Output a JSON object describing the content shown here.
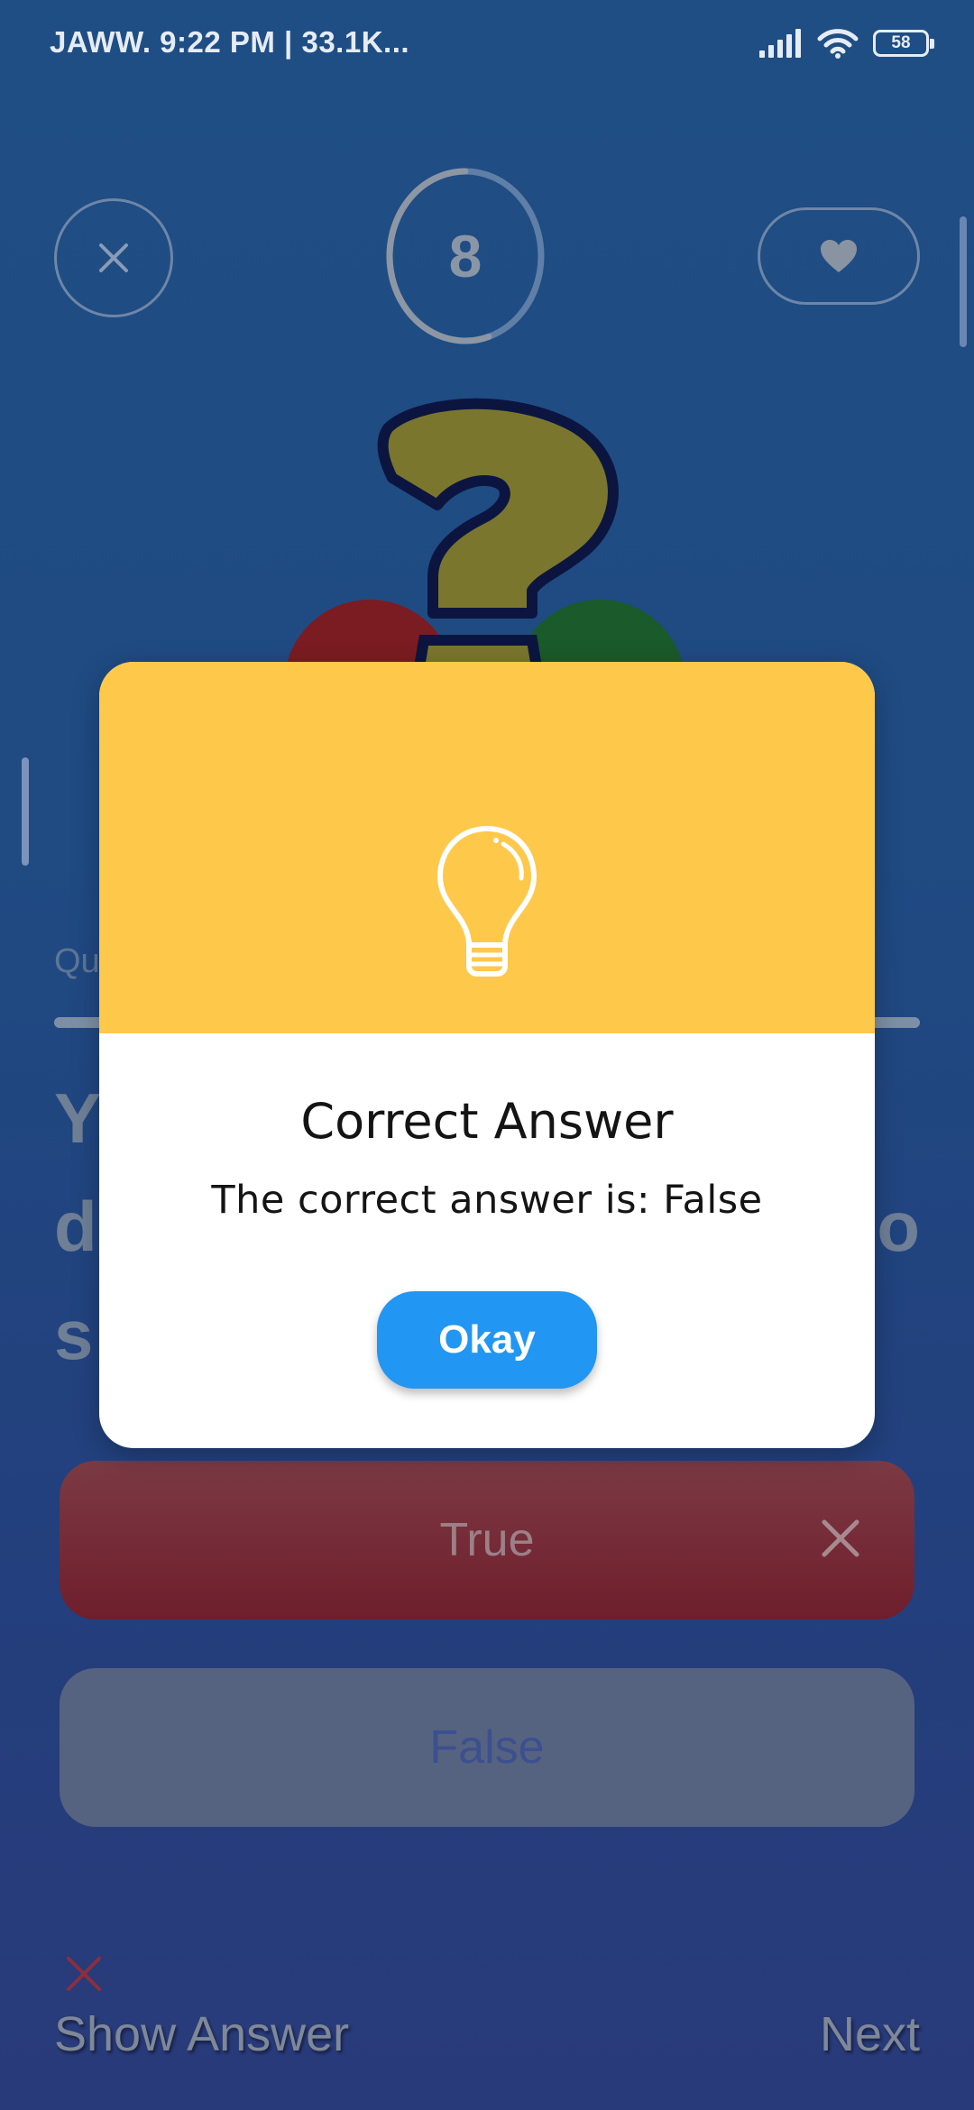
{
  "status_bar": {
    "left_text": "JAWW. 9:22 PM | 33.1K...",
    "battery": "58"
  },
  "game": {
    "timer_value": "8",
    "timer_progress": 0.55,
    "question_label": "Qu",
    "question_progress": 1.0,
    "question_fragments": {
      "line1_left": "Y",
      "line2_left": "d",
      "line2_right": "o",
      "line3_left": "s"
    },
    "answers": [
      {
        "label": "True",
        "state": "wrong"
      },
      {
        "label": "False",
        "state": "neutral"
      }
    ],
    "show_answer_label": "Show Answer",
    "next_label": "Next"
  },
  "dialog": {
    "title": "Correct Answer",
    "message": "The correct answer is: False",
    "okay_label": "Okay",
    "header_color": "#fec84b",
    "button_color": "#2196f3"
  },
  "icons": {
    "close": "close-icon",
    "heart": "heart-icon",
    "question_mark": "question-mark-icon",
    "lightbulb": "lightbulb-icon",
    "wrong": "x-mark-icon"
  }
}
